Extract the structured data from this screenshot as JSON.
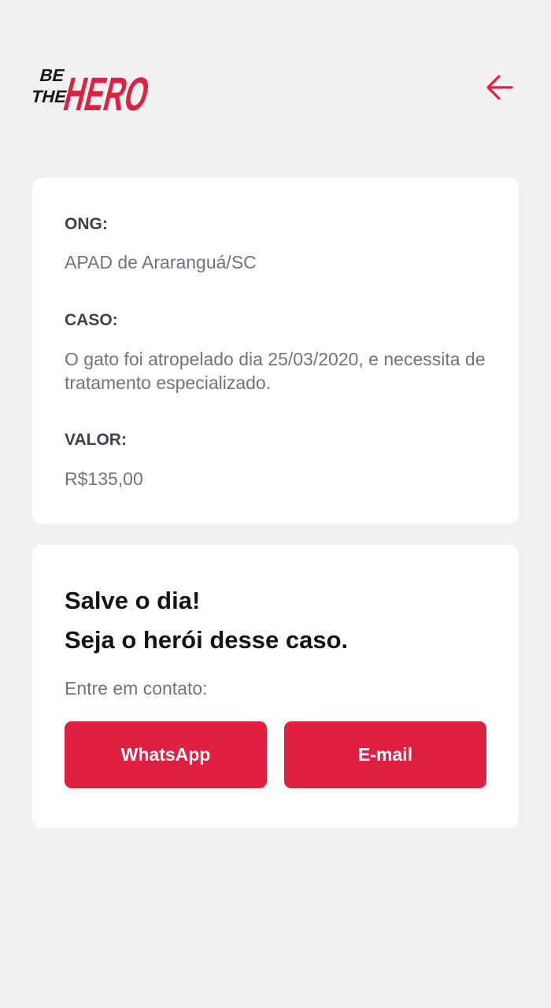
{
  "colors": {
    "brand": "#e02041",
    "background": "#f1f1f1",
    "card": "#ffffff",
    "label": "#41414d",
    "value": "#737380",
    "title": "#13131a"
  },
  "header": {
    "logo": {
      "line1": "BE",
      "line2": "THE",
      "word": "HERO"
    },
    "back_icon": "arrow-left-icon"
  },
  "incident": {
    "ong_label": "ONG:",
    "ong_value": "APAD de Araranguá/SC",
    "caso_label": "CASO:",
    "caso_value": "O gato foi atropelado dia 25/03/2020, e necessita de tratamento especializado.",
    "valor_label": "VALOR:",
    "valor_value": "R$135,00"
  },
  "contact": {
    "title_line1": "Salve o dia!",
    "title_line2": "Seja o herói desse caso.",
    "subtitle": "Entre em contato:",
    "whatsapp_label": "WhatsApp",
    "email_label": "E-mail"
  }
}
